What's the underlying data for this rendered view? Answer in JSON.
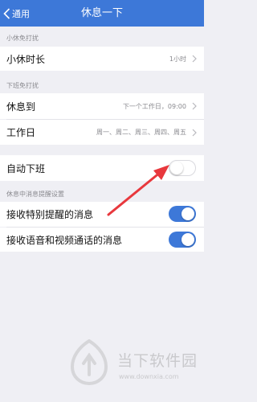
{
  "nav": {
    "back_label": "通用",
    "title": "休息一下"
  },
  "sections": {
    "short_break": {
      "header": "小休免打扰",
      "rows": [
        {
          "label": "小休时长",
          "value": "1小时"
        }
      ]
    },
    "off_work": {
      "header": "下班免打扰",
      "rows": [
        {
          "label": "休息到",
          "value": "下一个工作日，09:00"
        },
        {
          "label": "工作日",
          "value": "周一、周二、周三、周四、周五"
        }
      ]
    },
    "auto_off": {
      "label": "自动下班",
      "enabled": false
    },
    "notifications": {
      "header": "休息中消息提醒设置",
      "rows": [
        {
          "label": "接收特别提醒的消息",
          "enabled": true
        },
        {
          "label": "接收语音和视频通话的消息",
          "enabled": true
        }
      ]
    }
  },
  "colors": {
    "accent": "#3d78d8",
    "annotation_arrow": "#e8383d",
    "background": "#efeff4"
  },
  "watermark": {
    "name": "当下软件园",
    "url": "www.downxia.com"
  }
}
